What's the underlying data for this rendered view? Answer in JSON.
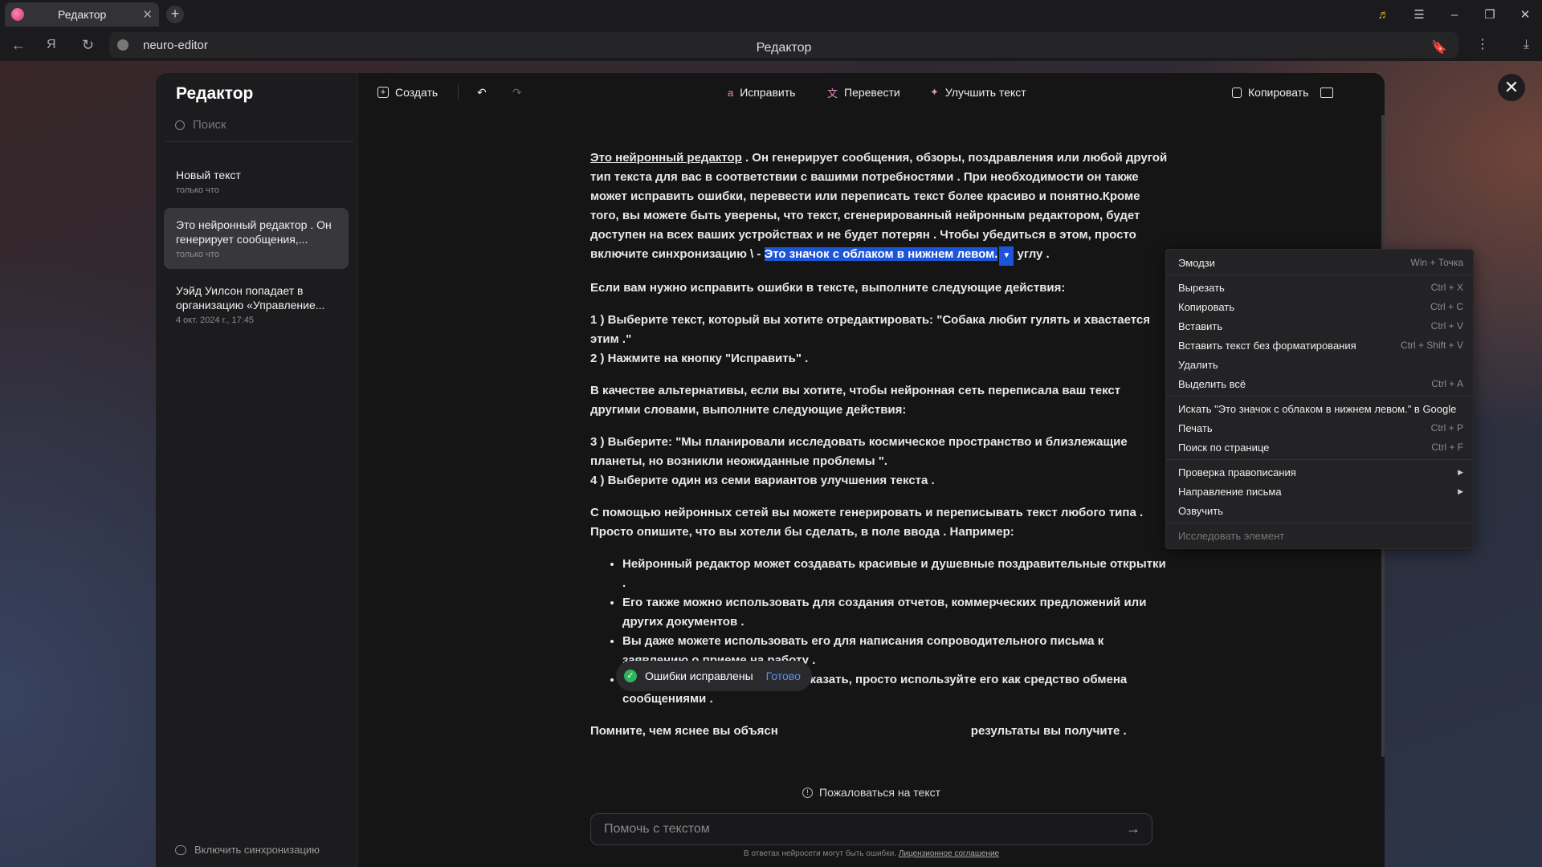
{
  "browser": {
    "tab_title": "Редактор",
    "tab_close": "✕",
    "new_tab": "+",
    "url": "neuro-editor",
    "page_title": "Редактор"
  },
  "sidebar": {
    "logo": "Редактор",
    "search_placeholder": "Поиск",
    "docs": [
      {
        "title": "Новый текст",
        "time": "только что"
      },
      {
        "title": "Это нейронный редактор . Он генерирует сообщения,...",
        "time": "только что"
      },
      {
        "title": "Уэйд Уилсон попадает в организацию «Управление...",
        "time": "4 окт. 2024 г., 17:45"
      }
    ],
    "sync_label": "Включить синхронизацию"
  },
  "toolbar": {
    "create": "Создать",
    "fix": "Исправить",
    "translate": "Перевести",
    "improve": "Улучшить текст",
    "copy": "Копировать"
  },
  "content": {
    "p1_link": "Это нейронный редактор",
    "p1_a": " . Он генерирует сообщения, обзоры, поздравления или любой другой тип текста для вас в соответствии с вашими потребностями . При необходимости он также может исправить ошибки, перевести или переписать текст более красиво и понятно.Кроме того, вы можете быть уверены, что текст, сгенерированный нейронным редактором, будет доступен на всех ваших устройствах и не будет потерян . Чтобы убедиться в этом, просто включите синхронизацию \\ - ",
    "p1_selected": "Это значок с облаком в нижнем левом.",
    "p1_b": " углу .",
    "p2": "Если вам нужно исправить ошибки в тексте, выполните следующие действия:",
    "p3_a": "1 ) Выберите текст, который вы хотите отредактировать: \"Собака любит гулять и хвастается этим .\"",
    "p3_b": "2 ) Нажмите на кнопку \"Исправить\" .",
    "p4": "В качестве альтернативы, если вы хотите, чтобы нейронная сеть переписала ваш текст другими словами, выполните следующие действия:",
    "p5_a": "3 ) Выберите: \"Мы планировали исследовать космическое пространство и близлежащие планеты, но возникли неожиданные проблемы \".",
    "p5_b": "4 ) Выберите один из семи вариантов улучшения текста .",
    "p6": "С помощью нейронных сетей вы можете генерировать и переписывать текст любого типа . Просто опишите, что вы хотели бы сделать, в поле ввода . Например:",
    "bullets": [
      "Нейронный редактор может создавать красивые и душевные поздравительные открытки .",
      "Его также можно использовать для создания отчетов, коммерческих предложений или других документов .",
      "Вы даже можете использовать его для написания сопроводительного письма к заявлению о приеме на работу .",
      "Или, если вам больше нечего сказать, просто используйте его как средство обмена сообщениями ."
    ],
    "p7_a": "Помните, чем яснее вы объясн",
    "p7_b": "результаты вы получите ."
  },
  "toast": {
    "text": "Ошибки исправлены",
    "action": "Готово"
  },
  "complain": "Пожаловаться на текст",
  "input_placeholder": "Помочь с текстом",
  "footer": {
    "text": "В ответах нейросети могут быть ошибки. ",
    "link": "Лицензионное соглашение"
  },
  "context_menu": [
    {
      "label": "Эмодзи",
      "shortcut": "Win + Точка"
    },
    {
      "label": "Вырезать",
      "shortcut": "Ctrl + X"
    },
    {
      "label": "Копировать",
      "shortcut": "Ctrl + C"
    },
    {
      "label": "Вставить",
      "shortcut": "Ctrl + V"
    },
    {
      "label": "Вставить текст без форматирования",
      "shortcut": "Ctrl + Shift + V"
    },
    {
      "label": "Удалить",
      "shortcut": ""
    },
    {
      "label": "Выделить всё",
      "shortcut": "Ctrl + A"
    },
    {
      "label": "Искать \"Это значок с облаком в нижнем левом.\" в Google",
      "shortcut": ""
    },
    {
      "label": "Печать",
      "shortcut": "Ctrl + P"
    },
    {
      "label": "Поиск по странице",
      "shortcut": "Ctrl + F"
    },
    {
      "label": "Проверка правописания",
      "shortcut": ""
    },
    {
      "label": "Направление письма",
      "shortcut": ""
    },
    {
      "label": "Озвучить",
      "shortcut": ""
    },
    {
      "label": "Исследовать элемент",
      "shortcut": ""
    }
  ],
  "colors": {
    "selection": "#1d55d9",
    "accent_link": "#5a90f5",
    "success": "#2db55d"
  }
}
